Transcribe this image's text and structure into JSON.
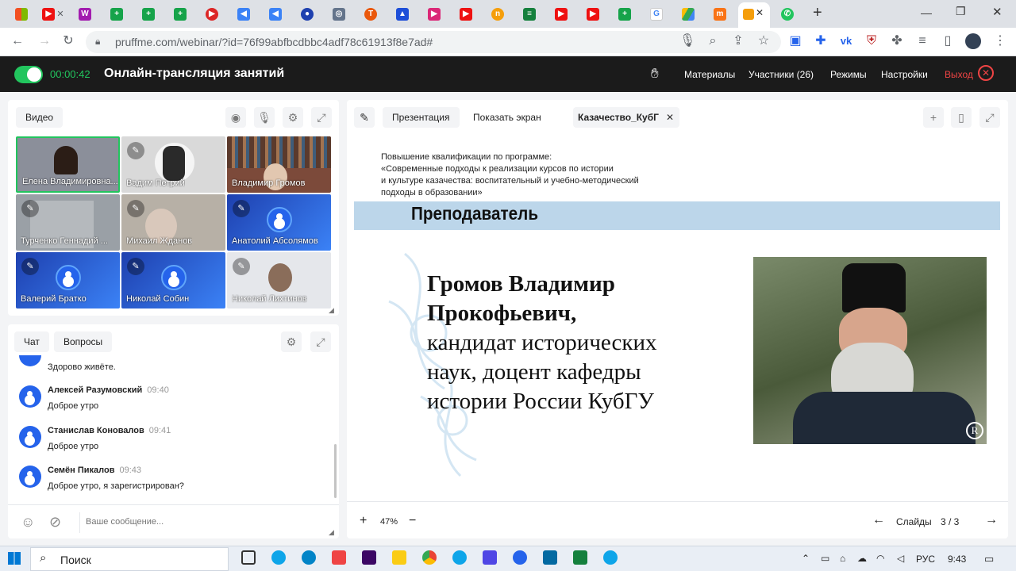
{
  "browser": {
    "url": "pruffme.com/webinar/?id=76f99abfbcdbbc4adf78c61913f8e7ad#",
    "new_tab": "+",
    "active_tab_close": "✕"
  },
  "app": {
    "timer": "00:00:42",
    "title": "Онлайн-трансляция занятий",
    "nav": [
      "Материалы",
      "Участники (26)",
      "Режимы",
      "Настройки"
    ],
    "exit": "Выход"
  },
  "video": {
    "tab": "Видео",
    "tiles": [
      {
        "name": "Елена Владимировна..."
      },
      {
        "name": "Вадим Петрий"
      },
      {
        "name": "Владимир Громов"
      },
      {
        "name": "Турченко Геннадий ..."
      },
      {
        "name": "Михаил Жданов"
      },
      {
        "name": "Анатолий Абсолямов"
      },
      {
        "name": "Валерий Братко"
      },
      {
        "name": "Николай Собин"
      },
      {
        "name": "Николай Лихтинов"
      }
    ]
  },
  "chat": {
    "tabs": [
      "Чат",
      "Вопросы"
    ],
    "partial_message": "Здорово живёте.",
    "messages": [
      {
        "author": "Алексей Разумовский",
        "time": "09:40",
        "text": "Доброе утро"
      },
      {
        "author": "Станислав Коновалов",
        "time": "09:41",
        "text": "Доброе утро"
      },
      {
        "author": "Семён Пикалов",
        "time": "09:43",
        "text": "Доброе утро, я зарегистрирован?"
      }
    ],
    "input_placeholder": "Ваше сообщение..."
  },
  "presentation": {
    "tabs": [
      "Презентация",
      "Показать экран"
    ],
    "file_tab": "Казачество_КубГ",
    "zoom": "47%",
    "zoom_in": "+",
    "zoom_out": "−",
    "slides_label": "Слайды",
    "slide_counter": "3 / 3"
  },
  "slide": {
    "header": [
      "Повышение  квалификации по программе:",
      "«Современные  подходы к реализации курсов по истории",
      "и культуре казачества: воспитательный и учебно-методический",
      "подходы в образовании»"
    ],
    "band_title": "Преподаватель",
    "name_line1": "Громов Владимир",
    "name_line2": "Прокофьевич,",
    "desc": [
      "кандидат исторических",
      "наук, доцент кафедры",
      "истории России КубГУ"
    ]
  },
  "taskbar": {
    "search": "Поиск",
    "lang": "РУС",
    "time": "9:43"
  },
  "colors": {
    "accent_green": "#22c55e",
    "exit_red": "#ef4444",
    "avatar_blue": "#2563eb"
  }
}
